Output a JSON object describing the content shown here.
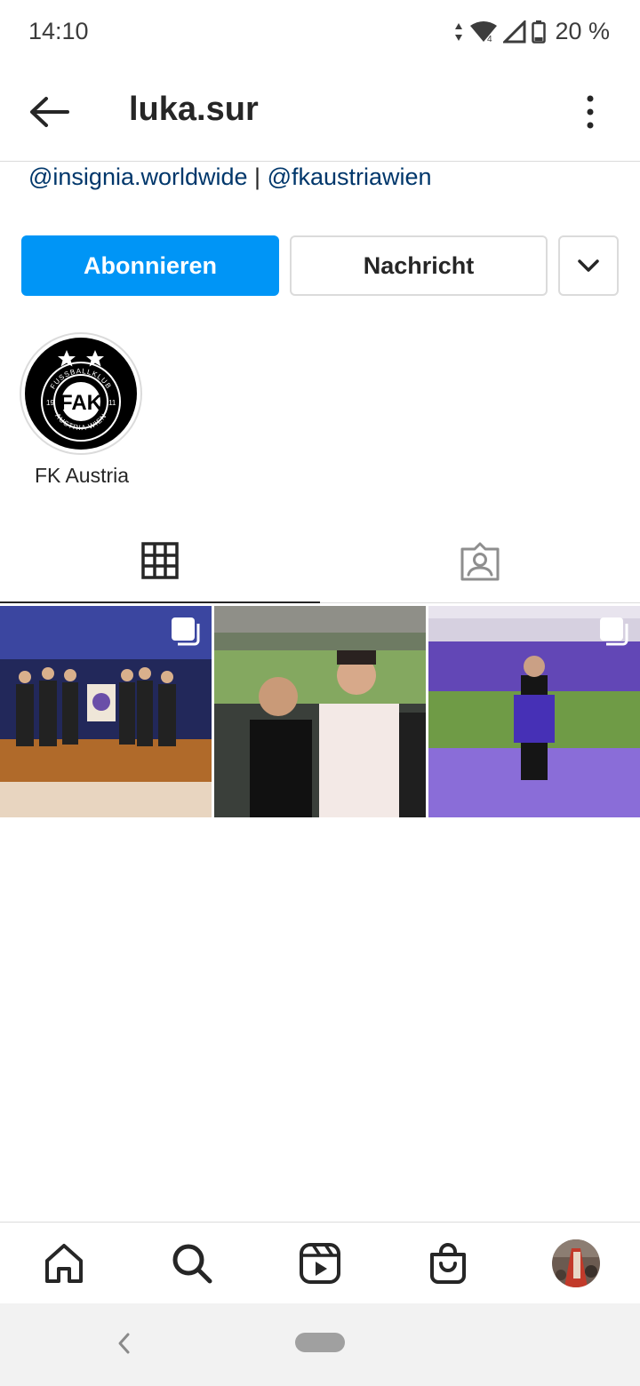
{
  "status_bar": {
    "time": "14:10",
    "battery": "20 %",
    "icons": [
      "data-arrows-icon",
      "wifi-icon",
      "signal-icon",
      "battery-icon"
    ]
  },
  "header": {
    "username": "luka.sur",
    "back_icon": "arrow-left-icon",
    "menu_icon": "more-vertical-icon"
  },
  "bio": {
    "link1": "@insignia.worldwide",
    "separator": "|",
    "link2": "@fkaustriawien"
  },
  "actions": {
    "follow_label": "Abonnieren",
    "message_label": "Nachricht",
    "more_icon": "chevron-down-icon"
  },
  "highlights": [
    {
      "label": "FK Austria",
      "icon": "fk-austria-logo"
    }
  ],
  "tabs": [
    {
      "name": "grid",
      "icon": "grid-icon",
      "active": true
    },
    {
      "name": "tagged",
      "icon": "tagged-person-icon",
      "active": false
    }
  ],
  "posts": [
    {
      "description_icon": "group-photo",
      "multi": true
    },
    {
      "description_icon": "stadium-selfie",
      "multi": false
    },
    {
      "description_icon": "stadium-jersey",
      "multi": true
    }
  ],
  "bottom_nav": [
    {
      "name": "home",
      "icon": "home-icon"
    },
    {
      "name": "search",
      "icon": "search-icon"
    },
    {
      "name": "reels",
      "icon": "reels-icon"
    },
    {
      "name": "shop",
      "icon": "shop-bag-icon"
    },
    {
      "name": "profile",
      "icon": "avatar"
    }
  ],
  "colors": {
    "accent": "#0095f6",
    "link": "#00376b",
    "text": "#262626",
    "border": "#dbdbdb"
  }
}
